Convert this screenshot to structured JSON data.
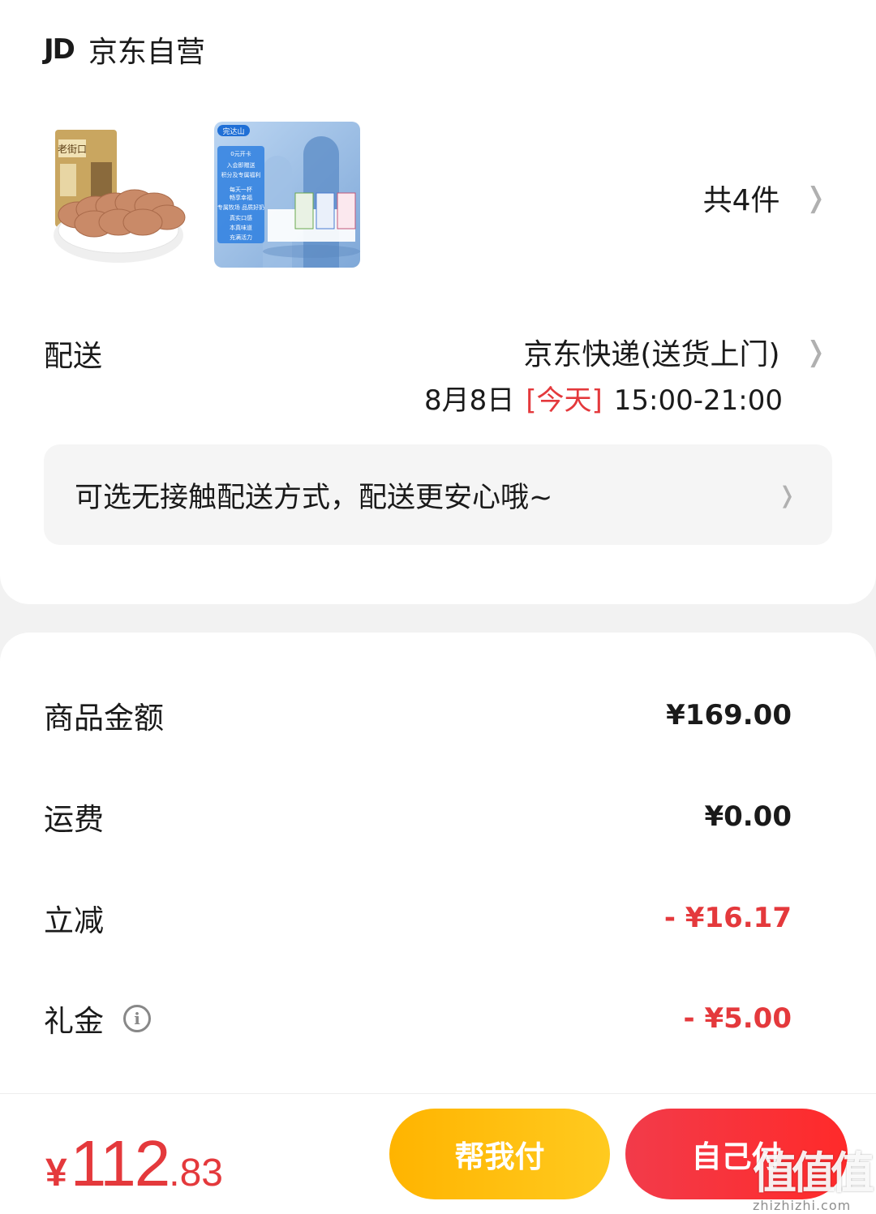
{
  "shop": {
    "logo": "JD",
    "name": "京东自营"
  },
  "products": {
    "count_label": "共4件",
    "thumb2_badge": "完达山",
    "thumb2_lines": [
      "0元开卡",
      "入会即赠送",
      "积分及专属福利",
      "每天一杯",
      "畅享幸福",
      "专属牧场 品质好奶",
      "真实口感",
      "本真味道",
      "充满活力"
    ],
    "thumb1_text": "老街口"
  },
  "delivery": {
    "label": "配送",
    "method": "京东快递(送货上门)",
    "date": "8月8日",
    "today": "[今天]",
    "time_range": "15:00-21:00"
  },
  "notice": {
    "text": "可选无接触配送方式，配送更安心哦~"
  },
  "fees": [
    {
      "label": "商品金额",
      "value": "¥169.00",
      "red": false,
      "info": false
    },
    {
      "label": "运费",
      "value": "¥0.00",
      "red": false,
      "info": false
    },
    {
      "label": "立减",
      "value": "- ¥16.17",
      "red": true,
      "info": false
    },
    {
      "label": "礼金",
      "value": "- ¥5.00",
      "red": true,
      "info": true
    }
  ],
  "bottom": {
    "currency": "¥",
    "total_int": "112",
    "total_dec": ".83",
    "help_pay": "帮我付",
    "self_pay": "自己付"
  },
  "watermark": {
    "logo": "值值值",
    "url": "zhizhizhi.com"
  },
  "colors": {
    "accent_red": "#e4393c",
    "help_btn": "#ffb400",
    "self_btn": "#f23b4a"
  }
}
